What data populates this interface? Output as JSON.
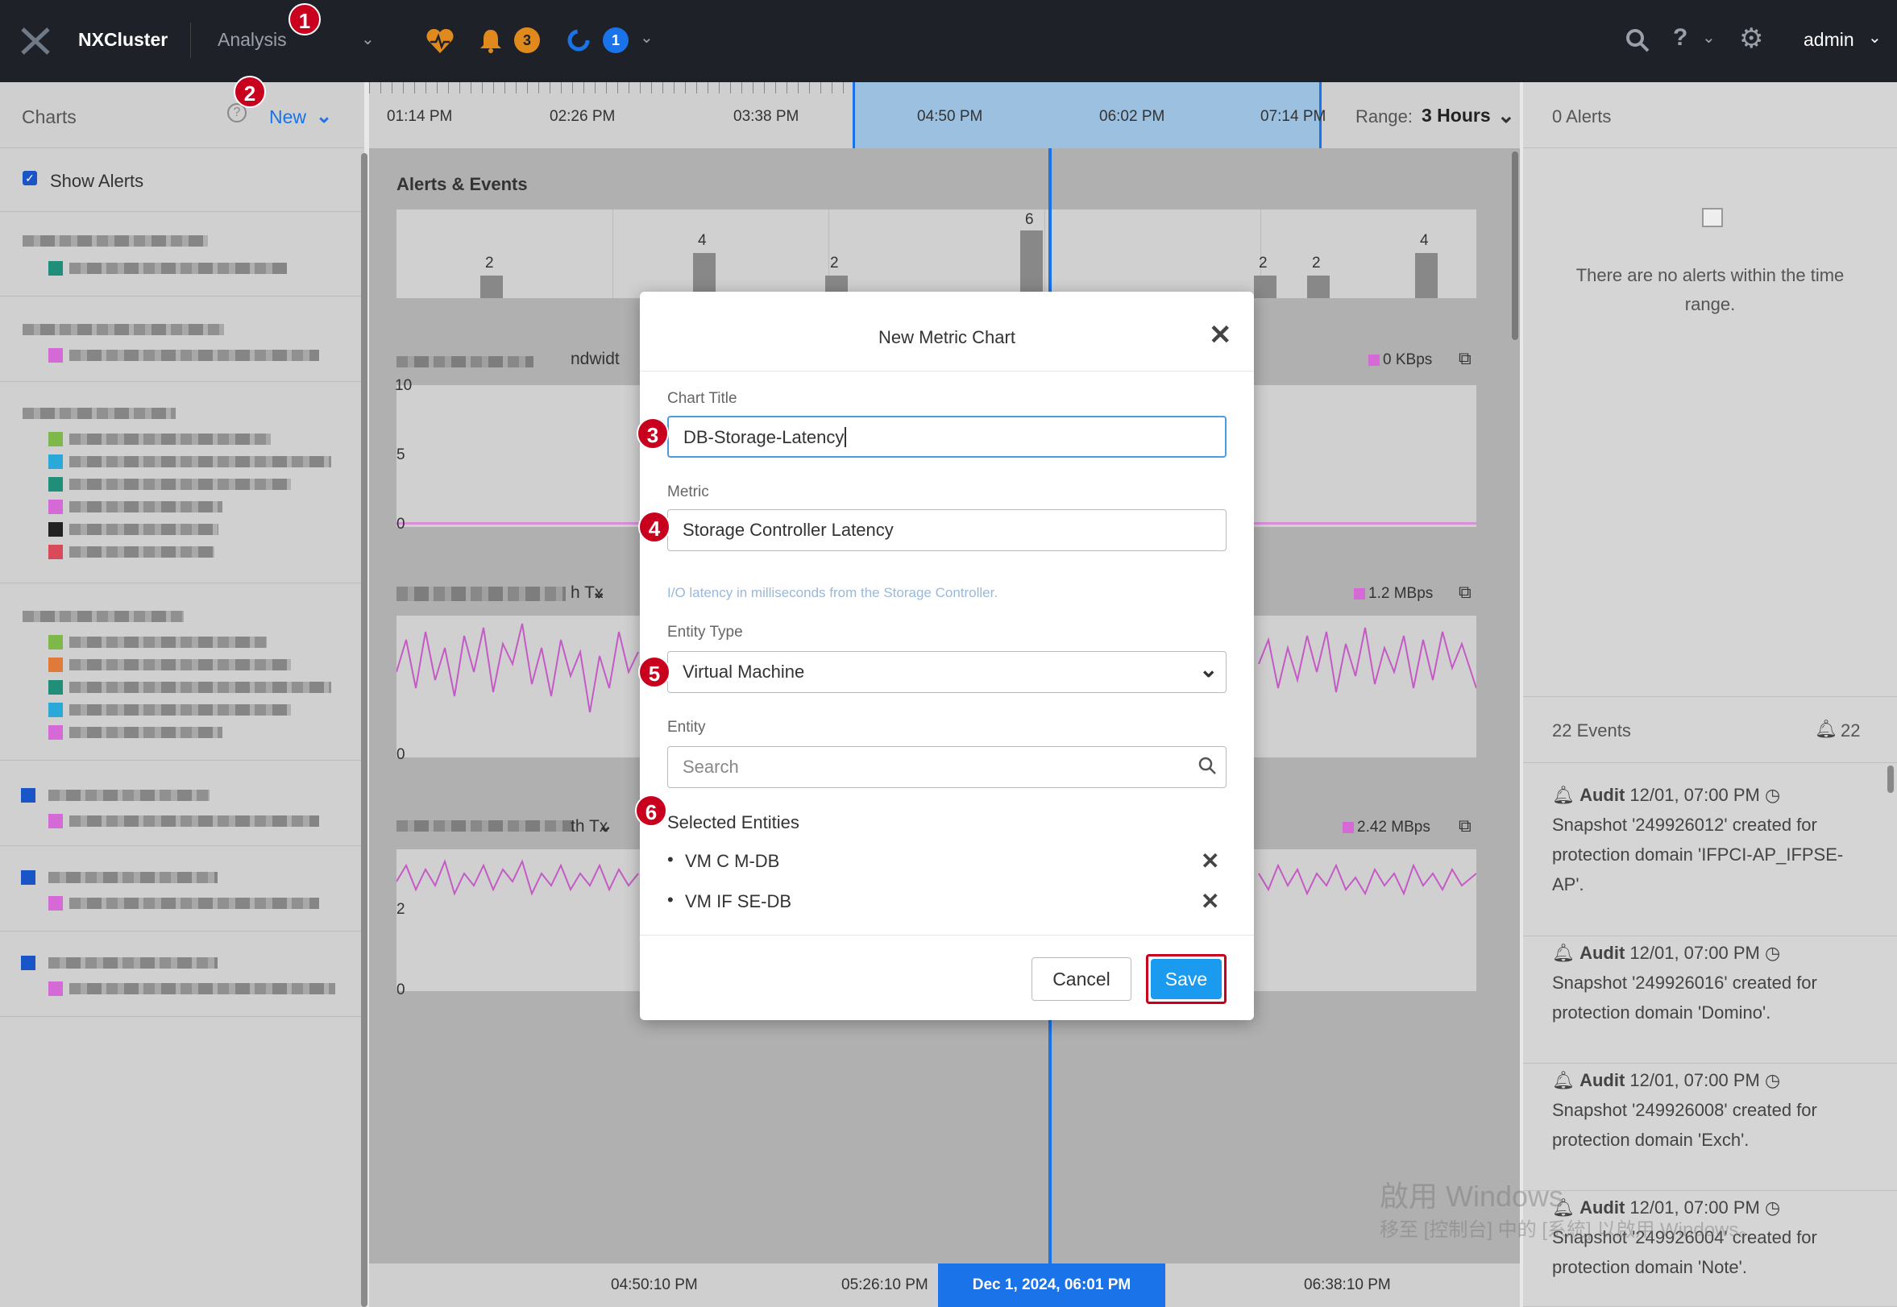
{
  "topbar": {
    "cluster_name": "NXCluster",
    "menu": "Analysis",
    "alerts_count": "3",
    "tasks_count": "1",
    "user": "admin",
    "colors": {
      "bg": "#1f2129",
      "alert_badge": "#e08a1e",
      "task_badge": "#1a73e8"
    }
  },
  "left_panel": {
    "title": "Charts",
    "new_label": "New",
    "show_alerts": "Show Alerts"
  },
  "timeline": {
    "ticks": [
      "01:14 PM",
      "02:26 PM",
      "03:38 PM",
      "04:50 PM",
      "06:02 PM",
      "07:14 PM"
    ],
    "range_label": "Range:",
    "range_value": "3 Hours"
  },
  "center": {
    "alerts_title": "Alerts & Events",
    "event_bars": [
      {
        "label": "2",
        "value": 2
      },
      {
        "label": "4",
        "value": 4
      },
      {
        "label": "2",
        "value": 2
      },
      {
        "label": "6",
        "value": 6
      },
      {
        "label": "2",
        "value": 2
      },
      {
        "label": "2",
        "value": 2
      },
      {
        "label": "4",
        "value": 4
      }
    ],
    "chart1": {
      "title_visible": "ndwidt",
      "value": "0 KBps",
      "yticks": [
        "10",
        "5",
        "0"
      ]
    },
    "chart2": {
      "title_visible": "h Tx",
      "value": "1.2 MBps",
      "yticks": [
        "0"
      ]
    },
    "chart3": {
      "title_visible": "th Tx",
      "value": "2.42 MBps",
      "yticks": [
        "2",
        "0"
      ]
    },
    "bottom_ticks": [
      "04:50:10 PM",
      "05:26:10 PM",
      "06:38:10 PM"
    ],
    "cursor_time": "Dec 1, 2024, 06:01 PM"
  },
  "right_panel": {
    "alerts_title": "0 Alerts",
    "no_alerts": "There are no alerts within the time range.",
    "events_title": "22 Events",
    "events_count": "22",
    "events": [
      {
        "type": "Audit",
        "time": "12/01, 07:00 PM",
        "text": "Snapshot '249926012' created for protection domain 'IFPCI-AP_IFPSE-AP'."
      },
      {
        "type": "Audit",
        "time": "12/01, 07:00 PM",
        "text": "Snapshot '249926016' created for protection domain 'Domino'."
      },
      {
        "type": "Audit",
        "time": "12/01, 07:00 PM",
        "text": "Snapshot '249926008' created for protection domain 'Exch'."
      },
      {
        "type": "Audit",
        "time": "12/01, 07:00 PM",
        "text": "Snapshot '249926004' created for protection domain 'Note'."
      }
    ]
  },
  "modal": {
    "title": "New Metric Chart",
    "chart_title_label": "Chart Title",
    "chart_title_value": "DB-Storage-Latency",
    "metric_label": "Metric",
    "metric_value": "Storage Controller Latency",
    "metric_help": "I/O latency in milliseconds from the Storage Controller.",
    "entity_type_label": "Entity Type",
    "entity_type_value": "Virtual Machine",
    "entity_label": "Entity",
    "entity_placeholder": "Search",
    "selected_label": "Selected Entities",
    "selected": [
      "VM C M-DB",
      "VM IF SE-DB"
    ],
    "cancel": "Cancel",
    "save": "Save",
    "colors": {
      "save": "#1a9bf0",
      "highlight": "#c8001e",
      "focus": "#4a9de0"
    }
  },
  "watermark": {
    "line1": "啟用 Windows",
    "line2": "移至 [控制台] 中的 [系統] 以啟用 Windows。"
  },
  "steps": [
    "1",
    "2",
    "3",
    "4",
    "5",
    "6"
  ]
}
